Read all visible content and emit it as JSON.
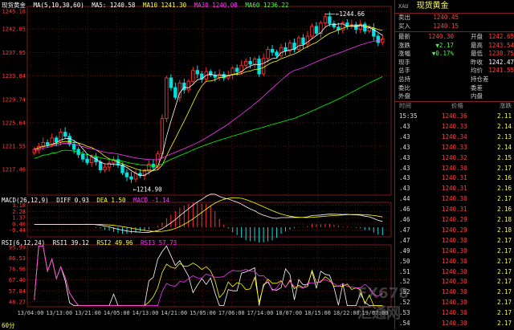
{
  "window_title": "现货黄金",
  "period_label": "60分",
  "price_legend": {
    "symbol": "现货黄金",
    "ma_spec": "MA(5,10,30,60)",
    "ma5": "MA5: 1240.58",
    "ma10": "MA10 1241.30",
    "ma30": "MA30 1240.08",
    "ma60": "MA60 1236.22"
  },
  "macd_legend": {
    "spec": "MACD(26,12,9)",
    "diff": "DIFF 0.93",
    "dea": "DEA 1.50",
    "macd": "MACD -1.14"
  },
  "rsi_legend": {
    "spec": "RSI(6,12,24)",
    "rsi1": "RSI1 39.12",
    "rsi2": "RSI2 49.96",
    "rsi3": "RSI3 57.73"
  },
  "annotations": {
    "high": "1244.66",
    "low": "1214.90"
  },
  "colors": {
    "up": "#ff3030",
    "down": "#00e0e0",
    "ma5": "#ffffff",
    "ma10": "#ffff00",
    "ma30": "#ff33ff",
    "ma60": "#00ff00",
    "grid": "#7a1a1a"
  },
  "quote_panel": {
    "header_tag": "XAU",
    "header_name": "现货黄金",
    "sell": {
      "label": "卖出",
      "value": "1240.45"
    },
    "buy": {
      "label": "买入",
      "value": "1240.15"
    },
    "rows": [
      {
        "l1": "最新",
        "v1": "1240.30",
        "l2": "开盘",
        "v2": "1242.65"
      },
      {
        "l1": "涨跌",
        "v1": "▼2.17",
        "l2": "最高",
        "v2": "1243.54"
      },
      {
        "l1": "涨幅",
        "v1": "▼0.17%",
        "l2": "最低",
        "v2": "1238.75"
      },
      {
        "l1": "现手",
        "v1": "",
        "l2": "昨收",
        "v2": "1242.47"
      },
      {
        "l1": "总手",
        "v1": "",
        "l2": "均价",
        "v2": "1241.55"
      },
      {
        "l1": "总持",
        "v1": "",
        "l2": "持仓差",
        "v2": ""
      },
      {
        "l1": "委比",
        "v1": "",
        "l2": "委差",
        "v2": ""
      },
      {
        "l1": "外盘",
        "v1": "",
        "l2": "内盘",
        "v2": ""
      }
    ],
    "tick_header": {
      "time": "时间",
      "price": "价格",
      "change": "涨跌"
    },
    "ticks": [
      {
        "t": "15:35",
        "p": "1240.36",
        "c": "2.11"
      },
      {
        "t": ".43",
        "p": "1240.33",
        "c": "2.14"
      },
      {
        "t": ".43",
        "p": "1240.34",
        "c": "2.13"
      },
      {
        "t": ".43",
        "p": "1240.33",
        "c": "2.14"
      },
      {
        "t": ".43",
        "p": "1240.32",
        "c": "2.15"
      },
      {
        "t": ".43",
        "p": "1240.30",
        "c": "2.17"
      },
      {
        "t": ".43",
        "p": "1240.31",
        "c": "2.16"
      },
      {
        "t": ".43",
        "p": "1240.31",
        "c": "2.16"
      },
      {
        "t": ".44",
        "p": "1240.30",
        "c": "2.17"
      },
      {
        "t": ".46",
        "p": "1240.31",
        "c": "2.16"
      },
      {
        "t": ".46",
        "p": "1240.29",
        "c": "2.18"
      },
      {
        "t": ".47",
        "p": "1240.29",
        "c": "2.18"
      },
      {
        "t": ".47",
        "p": "1240.30",
        "c": "2.17"
      },
      {
        "t": ".49",
        "p": "1240.30",
        "c": "2.17"
      },
      {
        "t": ".50",
        "p": "1240.30",
        "c": "2.17"
      },
      {
        "t": ".51",
        "p": "1240.30",
        "c": "2.17"
      },
      {
        "t": ".52",
        "p": "1240.30",
        "c": "2.17"
      },
      {
        "t": ".52",
        "p": "1240.30",
        "c": "2.17"
      },
      {
        "t": ".52",
        "p": "1240.30",
        "c": "2.17"
      },
      {
        "t": ".53",
        "p": "1240.30",
        "c": "2.17"
      },
      {
        "t": ".54",
        "p": "1240.30",
        "c": "2.17"
      }
    ]
  },
  "watermark": "FX678 汇通网",
  "chart_data": [
    {
      "type": "candlestick",
      "panel": "price",
      "ylim": [
        1213,
        1246
      ],
      "yticks": [
        "1245.18",
        "1242.05",
        "1237.95",
        "1233.84",
        "1229.74",
        "1225.64",
        "1221.55",
        "1217.46"
      ],
      "xticks": [
        "13/04:00",
        "13/13:00",
        "13/21:00",
        "14/05:00",
        "14/13:00",
        "14/21:00",
        "15/05:00",
        "17/06:00",
        "17/14:00",
        "18/07:00",
        "18/15:00",
        "18/22:00",
        "19/07:00"
      ],
      "series_close": [
        1221.0,
        1221.5,
        1222.2,
        1221.8,
        1223.0,
        1222.3,
        1224.0,
        1223.3,
        1221.9,
        1221.0,
        1220.1,
        1219.3,
        1218.7,
        1219.6,
        1218.8,
        1217.4,
        1217.9,
        1218.6,
        1219.2,
        1218.3,
        1216.9,
        1216.2,
        1215.8,
        1216.8,
        1216.4,
        1217.2,
        1218.4,
        1217.9,
        1220.2,
        1226.4,
        1233.5,
        1231.8,
        1230.1,
        1232.6,
        1231.4,
        1232.9,
        1234.8,
        1234.2,
        1233.3,
        1234.6,
        1234.0,
        1233.6,
        1234.1,
        1233.5,
        1234.0,
        1235.2,
        1234.6,
        1235.7,
        1236.4,
        1235.9,
        1236.8,
        1234.2,
        1236.9,
        1238.5,
        1238.0,
        1237.4,
        1238.8,
        1238.2,
        1239.6,
        1238.5,
        1240.5,
        1239.4,
        1240.8,
        1242.5,
        1241.3,
        1243.1,
        1244.2,
        1243.0,
        1242.4,
        1241.9,
        1243.1,
        1242.5,
        1242.8,
        1242.0,
        1242.9,
        1241.7,
        1242.2,
        1240.8,
        1239.7,
        1240.3
      ],
      "series_ma": {
        "MA5": "ma5",
        "MA10": "ma10",
        "MA30": "ma30",
        "MA60": "ma60"
      },
      "high_point": 1244.66,
      "low_point": 1214.9
    },
    {
      "type": "bar_line",
      "panel": "macd",
      "ylim": [
        -1.4,
        3.6
      ],
      "yticks": [
        "3.18",
        "2.28",
        "1.37",
        "0.46",
        "-0.44"
      ],
      "series": [
        {
          "name": "DIFF"
        },
        {
          "name": "DEA"
        },
        {
          "name": "MACD"
        }
      ],
      "values_last": {
        "diff": 0.93,
        "dea": 1.5,
        "macd": -1.14
      }
    },
    {
      "type": "line",
      "panel": "rsi",
      "ylim": [
        44,
        98
      ],
      "yticks": [
        "95.99",
        "86.53",
        "76.96",
        "67.40",
        "57.84",
        "48.27"
      ],
      "series": [
        {
          "name": "RSI1"
        },
        {
          "name": "RSI2"
        },
        {
          "name": "RSI3"
        }
      ],
      "values_last": {
        "rsi1": 39.12,
        "rsi2": 49.96,
        "rsi3": 57.73
      }
    }
  ]
}
